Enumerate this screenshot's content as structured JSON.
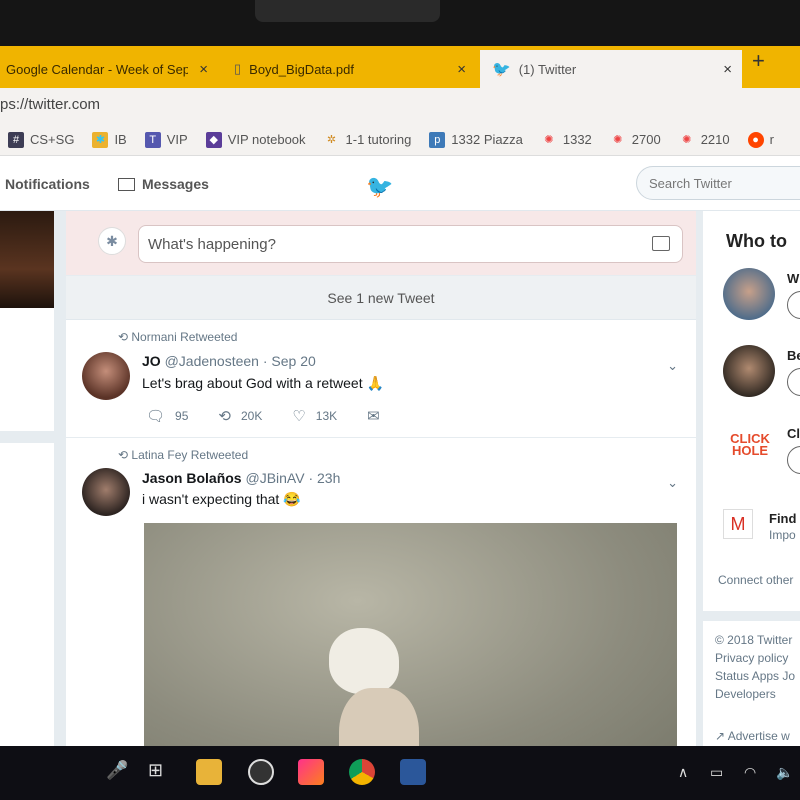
{
  "browser": {
    "tabs": [
      {
        "title": "Google Calendar - Week of Sept",
        "close": "×"
      },
      {
        "title": "Boyd_BigData.pdf",
        "close": "×"
      },
      {
        "title": "(1) Twitter",
        "close": "×"
      }
    ],
    "new_tab": "+",
    "url": "ps://twitter.com",
    "bookmarks": [
      {
        "label": "CS+SG",
        "icon": "#"
      },
      {
        "label": "IB",
        "icon": "slack"
      },
      {
        "label": "VIP",
        "icon": "TB"
      },
      {
        "label": "VIP notebook",
        "icon": "cube"
      },
      {
        "label": "1-1 tutoring",
        "icon": "star"
      },
      {
        "label": "1332 Piazza",
        "icon": "p"
      },
      {
        "label": "1332",
        "icon": "canvas"
      },
      {
        "label": "2700",
        "icon": "canvas"
      },
      {
        "label": "2210",
        "icon": "canvas"
      },
      {
        "label": "r",
        "icon": "reddit"
      }
    ]
  },
  "twitter": {
    "nav": {
      "notifications": "Notifications",
      "messages": "Messages",
      "search_placeholder": "Search Twitter"
    },
    "compose_placeholder": "What's happening?",
    "new_tweets": "See 1 new Tweet",
    "tweets": [
      {
        "retweeted_by": "Normani Retweeted",
        "name": "JO",
        "handle": "@Jadenosteen",
        "time": "· Sep 20",
        "text": "Let's brag about God with a retweet 🙏",
        "replies": "95",
        "retweets": "20K",
        "likes": "13K"
      },
      {
        "retweeted_by": "Latina Fey Retweeted",
        "name": "Jason Bolaños",
        "handle": "@JBinAV",
        "time": "· 23h",
        "text": "i wasn't expecting that 😂"
      }
    ],
    "sidebar": {
      "who_to_follow": "Who to",
      "suggestions": [
        "W",
        "Be",
        "Cl"
      ],
      "clickhole_logo": "CLICK HOLE",
      "find": "Find",
      "find_sub": "Impo",
      "connect": "Connect other",
      "footer": [
        "© 2018 Twitter",
        "Privacy policy",
        "Status  Apps  Jo",
        "Developers"
      ],
      "advertise": "Advertise w"
    }
  },
  "colors": {
    "accent": "#1da1f2",
    "tabbar": "#f0b400"
  }
}
